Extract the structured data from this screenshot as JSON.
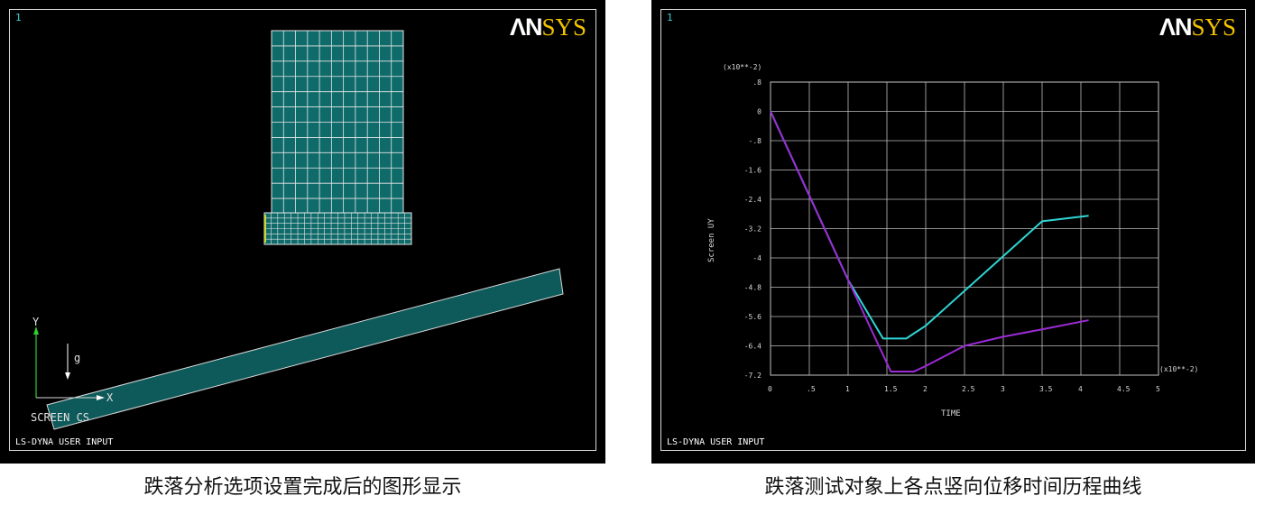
{
  "left_panel": {
    "window_number": "1",
    "logo_an": "ΛN",
    "logo_sys": "SYS",
    "axis_y_label": "Y",
    "axis_x_label": "X",
    "gravity_label": "g",
    "screen_cs_label": "SCREEN CS",
    "footer": "LS-DYNA USER INPUT",
    "colors": {
      "mesh": "#0f6a6a",
      "plate": "#0e5a5a",
      "axis": "#2fd02f"
    }
  },
  "right_panel": {
    "window_number": "1",
    "logo_an": "ΛN",
    "logo_sys": "SYS",
    "footer": "LS-DYNA USER INPUT",
    "chart_data": {
      "type": "line",
      "xlabel": "TIME",
      "ylabel": "Screen UY",
      "x_multiplier": "(x10**-2)",
      "y_multiplier": "(x10**-2)",
      "xlim": [
        0,
        5
      ],
      "ylim": [
        -7.2,
        0.8
      ],
      "x_ticks": [
        0,
        0.5,
        1,
        1.5,
        2,
        2.5,
        3,
        3.5,
        4,
        4.5,
        5
      ],
      "x_tick_labels": [
        "0",
        ".5",
        "1",
        "1.5",
        "2",
        "2.5",
        "3",
        "3.5",
        "4",
        "4.5",
        "5"
      ],
      "y_ticks": [
        0.8,
        0,
        -0.8,
        -1.6,
        -2.4,
        -3.2,
        -4.0,
        -4.8,
        -5.6,
        -6.4,
        -7.2
      ],
      "y_tick_labels": [
        ".8",
        "0",
        "-.8",
        "-1.6",
        "-2.4",
        "-3.2",
        "-4",
        "-4.8",
        "-5.6",
        "-6.4",
        "-7.2"
      ],
      "grid": true,
      "series": [
        {
          "color": "#2fd6d6",
          "x": [
            0,
            0.5,
            1.0,
            1.45,
            1.75,
            2.0,
            2.5,
            3.0,
            3.5,
            4.1
          ],
          "y": [
            0,
            -2.3,
            -4.6,
            -6.2,
            -6.2,
            -5.85,
            -4.9,
            -3.95,
            -3.0,
            -2.85
          ]
        },
        {
          "color": "#9b2bd6",
          "x": [
            0,
            0.5,
            1.0,
            1.55,
            1.85,
            2.0,
            2.5,
            3.0,
            3.5,
            4.1
          ],
          "y": [
            0,
            -2.3,
            -4.6,
            -7.1,
            -7.1,
            -6.95,
            -6.4,
            -6.15,
            -5.95,
            -5.7
          ]
        }
      ]
    }
  },
  "captions": {
    "left": "跌落分析选项设置完成后的图形显示",
    "right": "跌落测试对象上各点竖向位移时间历程曲线"
  }
}
